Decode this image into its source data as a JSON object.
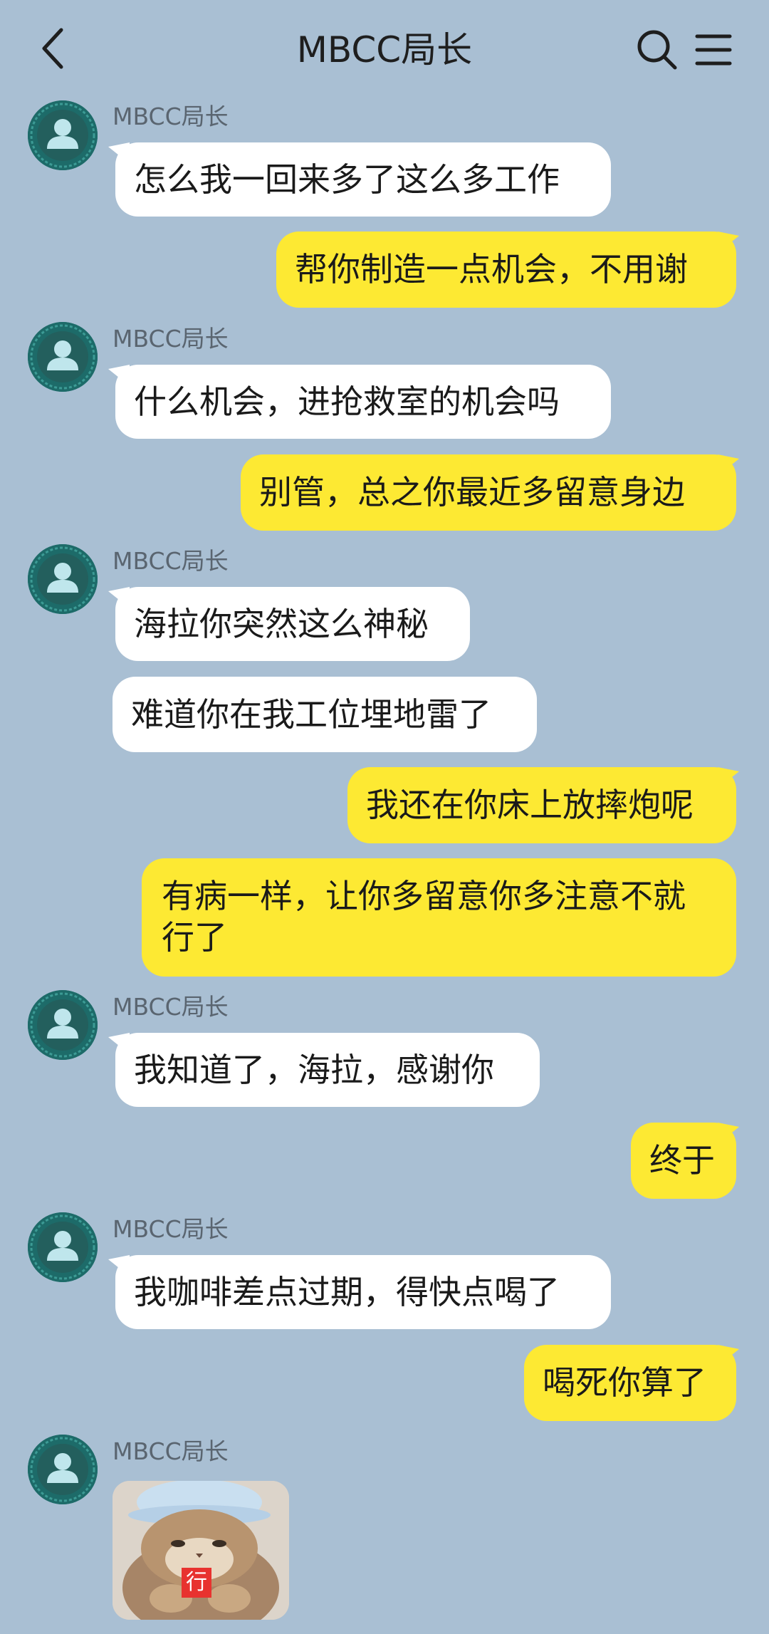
{
  "header": {
    "title": "MBCC局长"
  },
  "contact": {
    "name": "MBCC局长"
  },
  "messages": [
    {
      "side": "in",
      "text": "怎么我一回来多了这么多工作"
    },
    {
      "side": "out",
      "text": "帮你制造一点机会，不用谢"
    },
    {
      "side": "in",
      "text": "什么机会，进抢救室的机会吗"
    },
    {
      "side": "out",
      "text": "别管，总之你最近多留意身边"
    },
    {
      "side": "in",
      "text": "海拉你突然这么神秘"
    },
    {
      "side": "in",
      "text": "难道你在我工位埋地雷了"
    },
    {
      "side": "out",
      "text": "我还在你床上放摔炮呢"
    },
    {
      "side": "out",
      "text": "有病一样，让你多留意你多注意不就行了"
    },
    {
      "side": "in",
      "text": "我知道了，海拉，感谢你"
    },
    {
      "side": "out",
      "text": "终于"
    },
    {
      "side": "in",
      "text": "我咖啡差点过期，得快点喝了"
    },
    {
      "side": "out",
      "text": "喝死你算了"
    }
  ],
  "sticker": {
    "tag_text": "行"
  },
  "colors": {
    "background": "#a9bfd3",
    "incoming_bubble": "#ffffff",
    "outgoing_bubble": "#fde933",
    "avatar": "#1d6b69"
  },
  "icons": {
    "back": "chevron-left-icon",
    "search": "search-icon",
    "menu": "menu-icon",
    "avatar": "person-icon"
  }
}
